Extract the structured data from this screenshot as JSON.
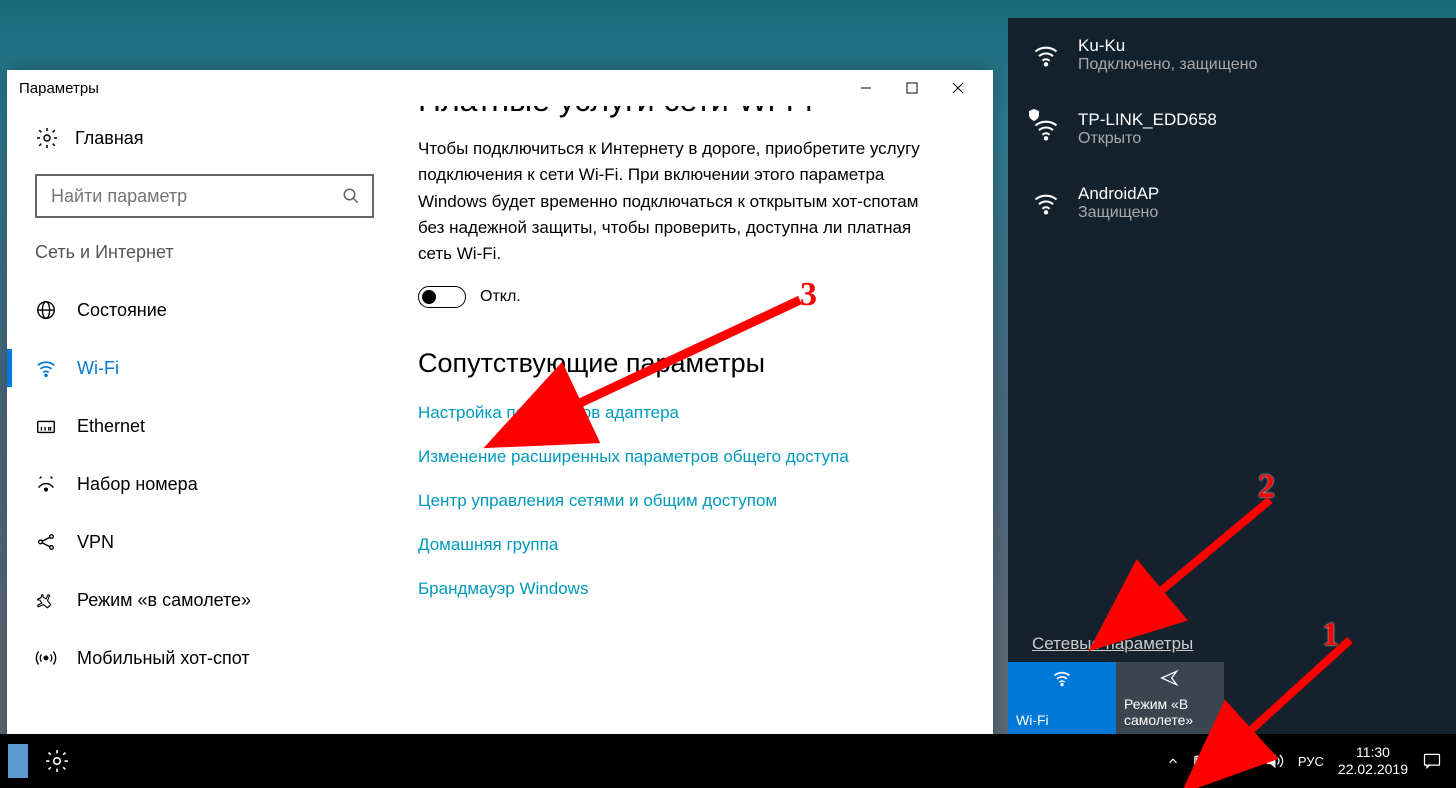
{
  "window": {
    "title": "Параметры"
  },
  "sidebar": {
    "home": "Главная",
    "search_placeholder": "Найти параметр",
    "section": "Сеть и Интернет",
    "items": [
      {
        "label": "Состояние"
      },
      {
        "label": "Wi-Fi"
      },
      {
        "label": "Ethernet"
      },
      {
        "label": "Набор номера"
      },
      {
        "label": "VPN"
      },
      {
        "label": "Режим «в самолете»"
      },
      {
        "label": "Мобильный хот-спот"
      }
    ]
  },
  "main": {
    "cut_title": "Платные услуги сети Wi-Fi",
    "desc": "Чтобы подключиться к Интернету в дороге, приобретите услугу подключения к сети Wi-Fi. При включении этого параметра Windows будет временно подключаться к открытым хот-спотам без надежной защиты, чтобы проверить, доступна ли платная сеть Wi-Fi.",
    "toggle_label": "Откл.",
    "related_heading": "Сопутствующие параметры",
    "links": [
      "Настройка параметров адаптера",
      "Изменение расширенных параметров общего доступа",
      "Центр управления сетями и общим доступом",
      "Домашняя группа",
      "Брандмауэр Windows"
    ]
  },
  "flyout": {
    "networks": [
      {
        "name": "Ku-Ku",
        "sub": "Подключено, защищено",
        "secured": true,
        "open": false
      },
      {
        "name": "TP-LINK_EDD658",
        "sub": "Открыто",
        "secured": false,
        "open": true
      },
      {
        "name": "AndroidAP",
        "sub": "Защищено",
        "secured": true,
        "open": false
      }
    ],
    "settings_link": "Сетевые параметры",
    "tile_wifi": "Wi-Fi",
    "tile_airplane": "Режим «В самолете»"
  },
  "tray": {
    "lang": "РУС",
    "time": "11:30",
    "date": "22.02.2019"
  },
  "annotations": {
    "n1": "1",
    "n2": "2",
    "n3": "3"
  }
}
